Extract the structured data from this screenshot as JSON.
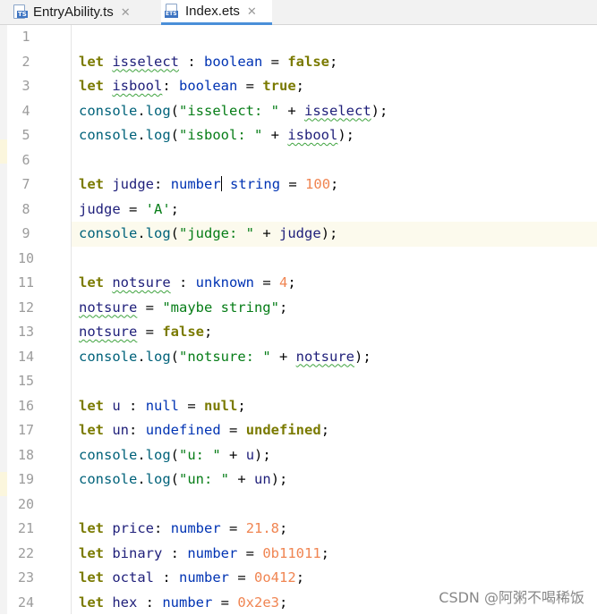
{
  "tabs": [
    {
      "label": "EntryAbility.ts",
      "icon": "ts-file-icon",
      "close": "✕"
    },
    {
      "label": "Index.ets",
      "icon": "ets-file-icon",
      "close": "✕"
    }
  ],
  "icon_badges": {
    "ts": "TS",
    "ets": "ETS"
  },
  "line_numbers": [
    "1",
    "2",
    "3",
    "4",
    "5",
    "6",
    "7",
    "8",
    "9",
    "10",
    "11",
    "12",
    "13",
    "14",
    "15",
    "16",
    "17",
    "18",
    "19",
    "20",
    "21",
    "22",
    "23",
    "24"
  ],
  "code": {
    "let": "let",
    "console": "console",
    "log": "log",
    "l2": {
      "name": "isselect",
      "sep": " : ",
      "type": "boolean",
      "eq": " = ",
      "value": "false",
      "end": ";"
    },
    "l3": {
      "name": "isbool",
      "sep": ": ",
      "type": "boolean",
      "eq": " = ",
      "value": "true",
      "end": ";"
    },
    "l4": {
      "str": "\"isselect: \"",
      "plus": " + ",
      "arg": "isselect",
      "end": ");"
    },
    "l5": {
      "str": "\"isbool: \"",
      "plus": " + ",
      "arg": "isbool",
      "end": ");"
    },
    "l7": {
      "name": "judge",
      "sep": ": ",
      "type1": "number",
      "bar": " ",
      "type2": "string",
      "eq": " = ",
      "value": "100",
      "end": ";"
    },
    "l8": {
      "name": "judge",
      "eq": " = ",
      "value": "'A'",
      "end": ";"
    },
    "l9": {
      "str": "\"judge: \"",
      "plus": " + ",
      "arg": "judge",
      "end": ");"
    },
    "l11": {
      "name": "notsure",
      "sep": " : ",
      "type": "unknown",
      "eq": " = ",
      "value": "4",
      "end": ";"
    },
    "l12": {
      "name": "notsure",
      "eq": " = ",
      "value": "\"maybe string\"",
      "end": ";"
    },
    "l13": {
      "name": "notsure",
      "eq": " = ",
      "value": "false",
      "end": ";"
    },
    "l14": {
      "str": "\"notsure: \"",
      "plus": " + ",
      "arg": "notsure",
      "end": ");"
    },
    "l16": {
      "name": "u",
      "sep": " : ",
      "type": "null",
      "eq": " = ",
      "value": "null",
      "end": ";"
    },
    "l17": {
      "name": "un",
      "sep": ": ",
      "type": "undefined",
      "eq": " = ",
      "value": "undefined",
      "end": ";"
    },
    "l18": {
      "str": "\"u: \"",
      "plus": " + ",
      "arg": "u",
      "end": ");"
    },
    "l19": {
      "str": "\"un: \"",
      "plus": " + ",
      "arg": "un",
      "end": ");"
    },
    "l21": {
      "name": "price",
      "sep": ": ",
      "type": "number",
      "eq": " = ",
      "value": "21.8",
      "end": ";"
    },
    "l22": {
      "name": "binary",
      "sep": " : ",
      "type": "number",
      "eq": " = ",
      "value": "0b11011",
      "end": ";"
    },
    "l23": {
      "name": "octal",
      "sep": " : ",
      "type": "number",
      "eq": " = ",
      "value": "0o412",
      "end": ";"
    },
    "l24": {
      "name": "hex",
      "sep": " : ",
      "type": "number",
      "eq": " = ",
      "value": "0x2e3",
      "end": ";"
    }
  },
  "watermark": "CSDN @阿粥不喝稀饭",
  "colors": {
    "keyword": "#7a7a00",
    "type": "#0033b3",
    "string": "#067d17",
    "number": "#f08552",
    "accent": "#4a8fd9"
  }
}
